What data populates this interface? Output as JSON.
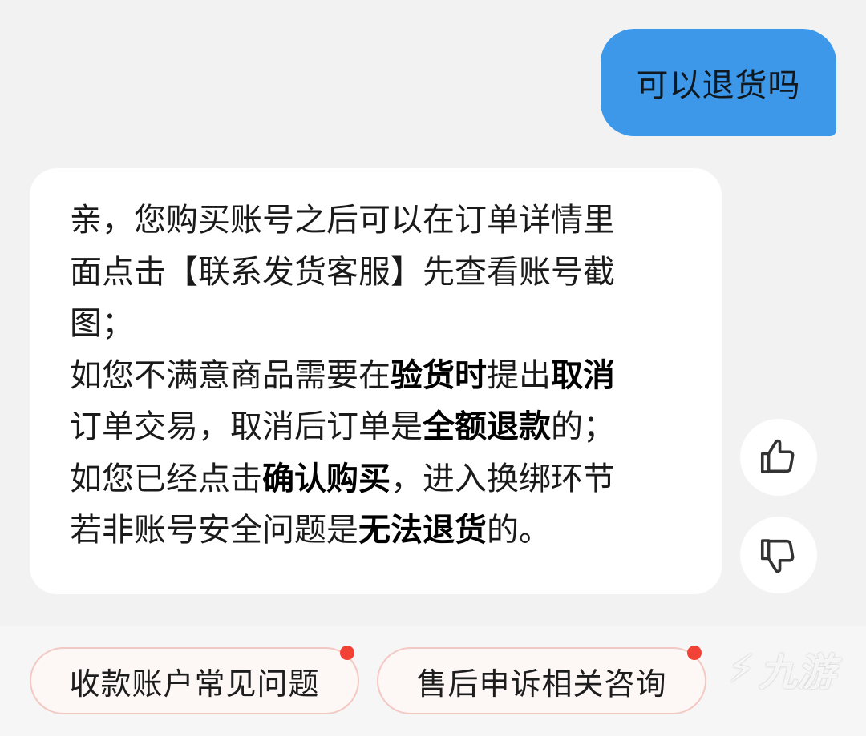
{
  "chat": {
    "user_message": "可以退货吗",
    "bot_message": {
      "lines": [
        [
          {
            "t": "亲，您购买账号之后可以在订单详情里"
          }
        ],
        [
          {
            "t": "面点击【联系发货客服】先查看账号截"
          }
        ],
        [
          {
            "t": "图；"
          }
        ],
        [
          {
            "t": "如您不满意商品需要在"
          },
          {
            "t": "验货时",
            "b": true
          },
          {
            "t": "提出"
          },
          {
            "t": "取消",
            "b": true
          }
        ],
        [
          {
            "t": "订单交易，取消后订单是"
          },
          {
            "t": "全额退款",
            "b": true
          },
          {
            "t": "的；"
          }
        ],
        [
          {
            "t": "如您已经点击"
          },
          {
            "t": "确认购买",
            "b": true
          },
          {
            "t": "，进入换绑环节"
          }
        ],
        [
          {
            "t": "若非账号安全问题是"
          },
          {
            "t": "无法退货",
            "b": true
          },
          {
            "t": "的。"
          }
        ]
      ]
    }
  },
  "feedback": {
    "like_icon": "thumbs-up-icon",
    "dislike_icon": "thumbs-down-icon"
  },
  "quick_replies": [
    {
      "label": "收款账户常见问题",
      "has_dot": true
    },
    {
      "label": "售后申诉相关咨询",
      "has_dot": true
    }
  ],
  "watermark": {
    "text": "九游"
  },
  "colors": {
    "user_bubble": "#3d98ea",
    "chip_border": "#f4c8c3",
    "notification_dot": "#f24236"
  }
}
